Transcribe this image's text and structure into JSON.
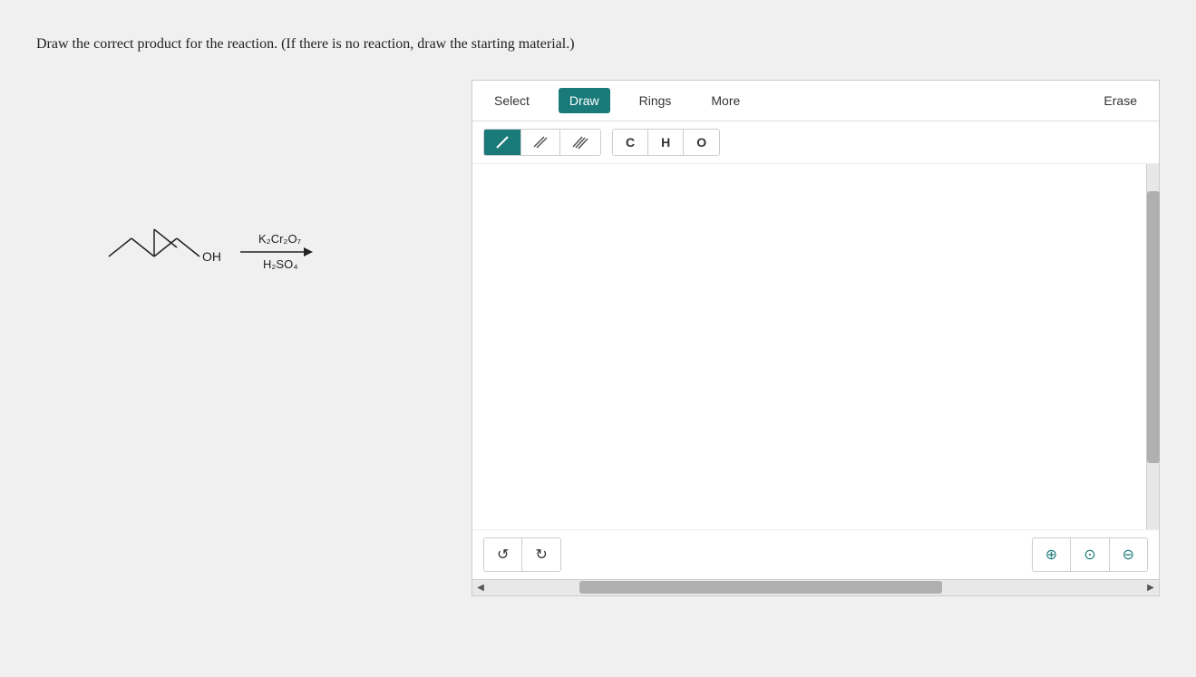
{
  "page": {
    "question": "Draw the correct product for the reaction. (If there is no reaction, draw the starting material.)"
  },
  "toolbar": {
    "select_label": "Select",
    "draw_label": "Draw",
    "rings_label": "Rings",
    "more_label": "More",
    "erase_label": "Erase",
    "active_tool": "draw"
  },
  "bonds": {
    "single_label": "/",
    "double_label": "//",
    "triple_label": "///"
  },
  "atoms": {
    "carbon": "C",
    "hydrogen": "H",
    "oxygen": "O"
  },
  "bottom_toolbar": {
    "undo_label": "↺",
    "redo_label": "↻",
    "zoom_in_label": "⊕",
    "zoom_reset_label": "⊙",
    "zoom_out_label": "⊖"
  },
  "reaction": {
    "reagent_above": "K₂Cr₂O₇",
    "reagent_below": "H₂SO₄"
  }
}
